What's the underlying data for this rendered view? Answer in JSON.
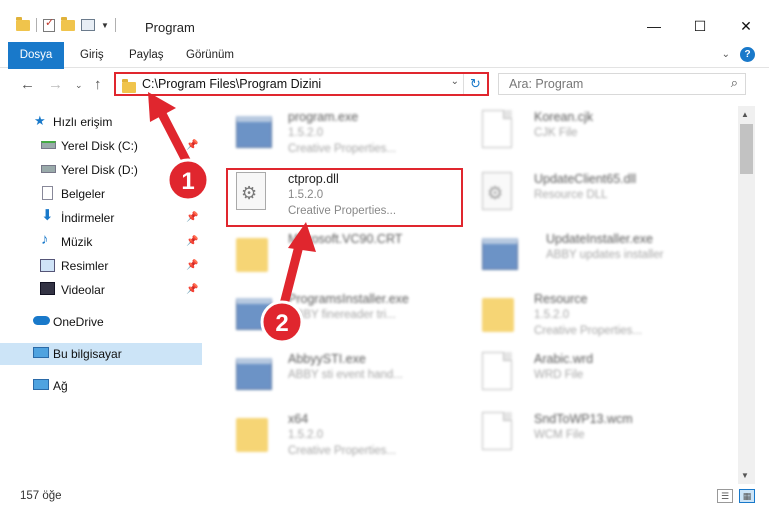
{
  "window": {
    "title": "Program",
    "minimize": "—",
    "maximize": "☐",
    "close": "✕"
  },
  "ribbon": {
    "tabs": [
      "Dosya",
      "Giriş",
      "Paylaş",
      "Görünüm"
    ],
    "help": "?"
  },
  "address": {
    "path": "C:\\Program Files\\Program Dizini",
    "search_placeholder": "Ara: Program"
  },
  "sidebar": {
    "items": [
      {
        "label": "Hızlı erişim",
        "icon": "star-icon"
      },
      {
        "label": "Yerel Disk (C:)",
        "icon": "drive-icon"
      },
      {
        "label": "Yerel Disk (D:)",
        "icon": "drive-icon"
      },
      {
        "label": "Belgeler",
        "icon": "documents-icon"
      },
      {
        "label": "İndirmeler",
        "icon": "download-icon"
      },
      {
        "label": "Müzik",
        "icon": "music-icon"
      },
      {
        "label": "Resimler",
        "icon": "pictures-icon"
      },
      {
        "label": "Videolar",
        "icon": "video-icon"
      },
      {
        "label": "OneDrive",
        "icon": "cloud-icon"
      },
      {
        "label": "Bu bilgisayar",
        "icon": "computer-icon"
      },
      {
        "label": "Ağ",
        "icon": "network-icon"
      }
    ]
  },
  "files": [
    {
      "name": "program.exe",
      "l2": "1.5.2.0",
      "l3": "Creative Properties...",
      "icon": "app-icon"
    },
    {
      "name": "Korean.cjk",
      "l2": "CJK File",
      "l3": "",
      "icon": "document-icon"
    },
    {
      "name": "ctprop.dll",
      "l2": "1.5.2.0",
      "l3": "Creative Properties...",
      "icon": "gear-file-icon"
    },
    {
      "name": "UpdateClient65.dll",
      "l2": "Resource DLL",
      "l3": "",
      "icon": "gear-file-icon"
    },
    {
      "name": "Microsoft.VC90.CRT",
      "l2": "",
      "l3": "",
      "icon": "folder-icon"
    },
    {
      "name": "UpdateInstaller.exe",
      "l2": "ABBY updates installer",
      "l3": "",
      "icon": "app-icon"
    },
    {
      "name": "ProgramsInstaller.exe",
      "l2": "ABBY finereader tri...",
      "l3": "",
      "icon": "app-icon"
    },
    {
      "name": "Resource",
      "l2": "1.5.2.0",
      "l3": "Creative Properties...",
      "icon": "folder-icon"
    },
    {
      "name": "AbbyySTI.exe",
      "l2": "ABBY sti event hand...",
      "l3": "",
      "icon": "app-icon"
    },
    {
      "name": "Arabic.wrd",
      "l2": "WRD File",
      "l3": "",
      "icon": "document-icon"
    },
    {
      "name": "x64",
      "l2": "1.5.2.0",
      "l3": "Creative Properties...",
      "icon": "folder-icon"
    },
    {
      "name": "SndToWP13.wcm",
      "l2": "WCM File",
      "l3": "",
      "icon": "document-icon"
    }
  ],
  "status": {
    "count": "157 öğe"
  },
  "annotations": {
    "badge1": "1",
    "badge2": "2",
    "color": "#e0262e"
  }
}
